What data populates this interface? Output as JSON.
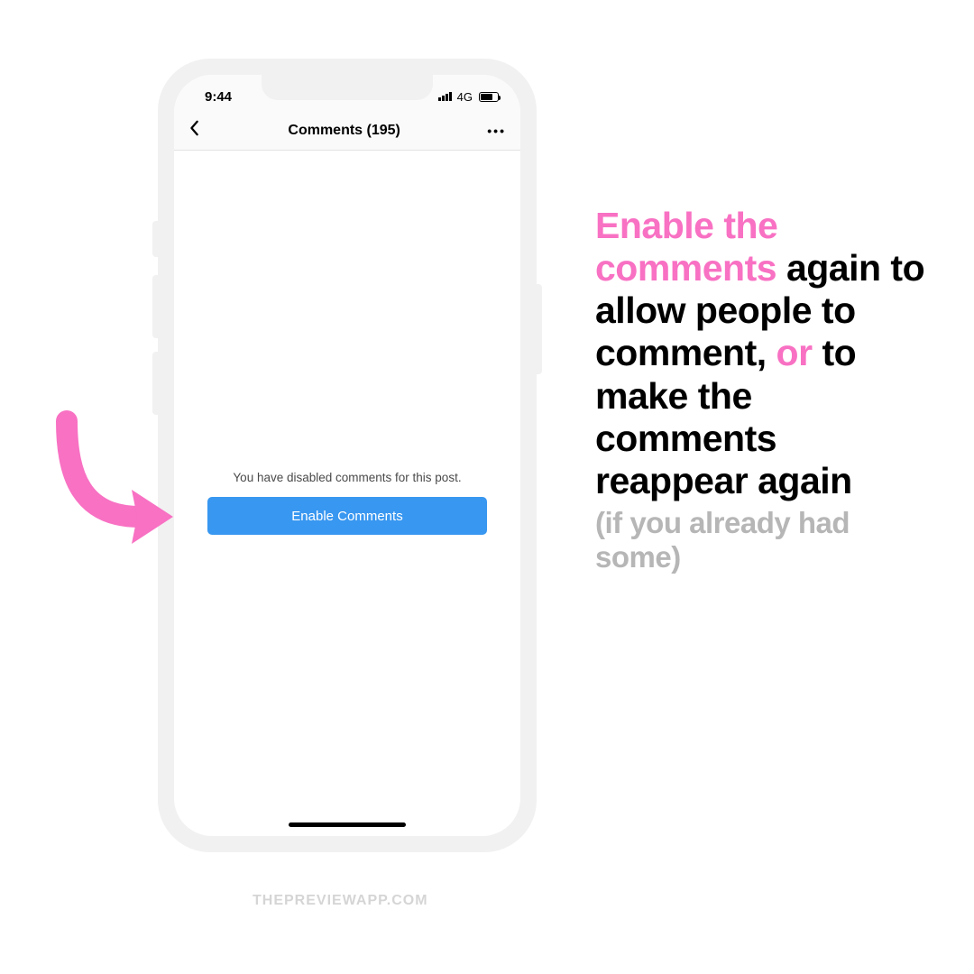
{
  "statusbar": {
    "time": "9:44",
    "network": "4G"
  },
  "nav": {
    "title": "Comments (195)"
  },
  "body": {
    "disabled_message": "You have disabled comments for this post.",
    "enable_button": "Enable Comments"
  },
  "sidetext": {
    "p1_pink": "Enable the comments",
    "p1_black_a": " again to allow people to comment, ",
    "p1_pink2": "or",
    "p1_black_b": " to make the comments reappear again",
    "p2_grey": "(if you already had some)"
  },
  "footer": "THEPREVIEWAPP.COM",
  "colors": {
    "accent_pink": "#f871c3",
    "button_blue": "#3897f0"
  }
}
